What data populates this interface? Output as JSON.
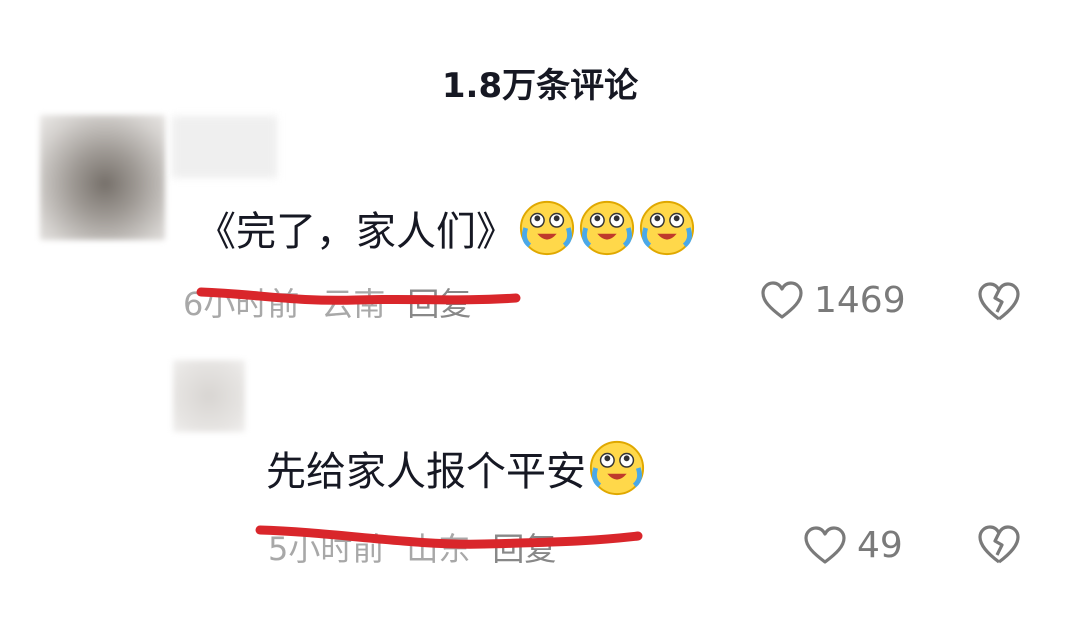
{
  "header": {
    "title": "1.8万条评论"
  },
  "comments": [
    {
      "username": "",
      "text": "《完了，家人们》",
      "emojis": [
        "crying-laughing-emoji",
        "crying-laughing-emoji",
        "crying-laughing-emoji"
      ],
      "time": "6小时前",
      "location": "云南",
      "reply_label": "回复",
      "likes": "1469"
    }
  ],
  "replies": [
    {
      "username": "",
      "text": "先给家人报个平安",
      "emojis": [
        "crying-laughing-emoji"
      ],
      "time": "5小时前",
      "location": "山东",
      "reply_label": "回复",
      "likes": "49"
    }
  ],
  "colors": {
    "text": "#161823",
    "meta": "#a8a8a8",
    "scribble": "#d9262b",
    "icon": "#7a7a7a"
  }
}
